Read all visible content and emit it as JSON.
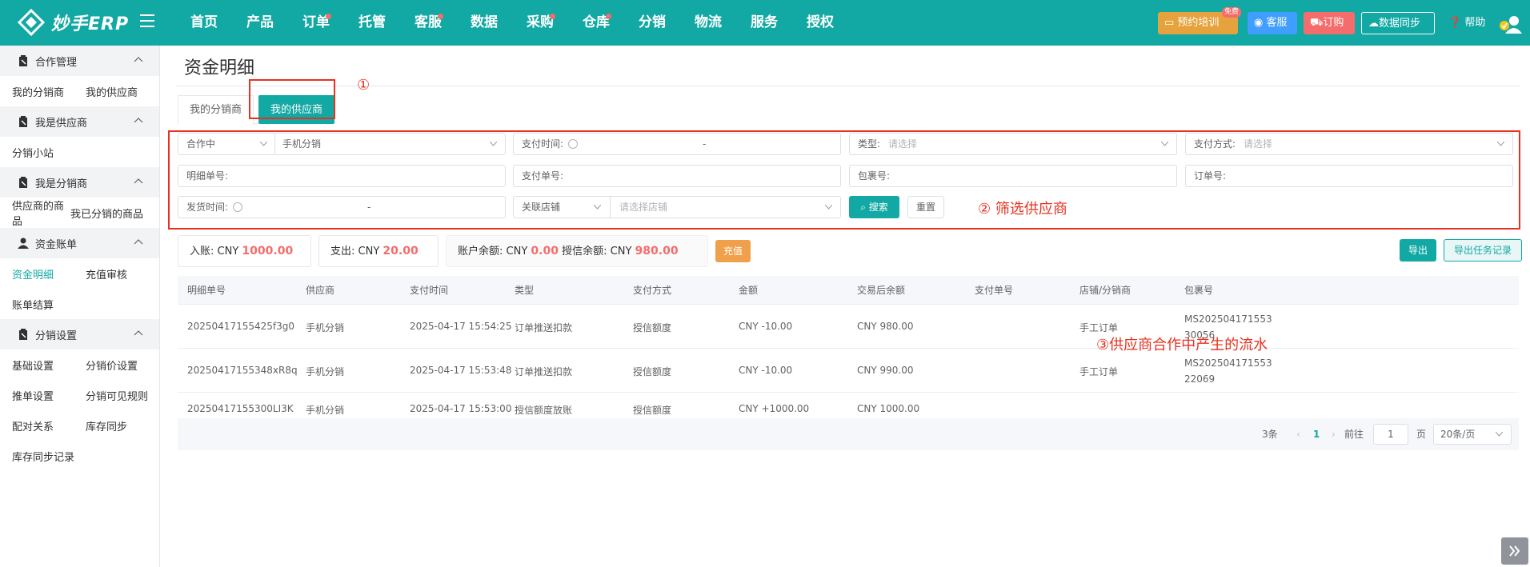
{
  "header": {
    "logo_text": "妙手ERP",
    "nav": [
      {
        "label": "首页",
        "dot": false
      },
      {
        "label": "产品",
        "dot": false
      },
      {
        "label": "订单",
        "dot": true
      },
      {
        "label": "托管",
        "dot": false
      },
      {
        "label": "客服",
        "dot": true
      },
      {
        "label": "数据",
        "dot": false
      },
      {
        "label": "采购",
        "dot": true
      },
      {
        "label": "仓库",
        "dot": true
      },
      {
        "label": "分销",
        "dot": false
      },
      {
        "label": "物流",
        "dot": false
      },
      {
        "label": "服务",
        "dot": false
      },
      {
        "label": "授权",
        "dot": false
      }
    ],
    "train_label": "预约培训",
    "train_badge": "免费",
    "cs_label": "客服",
    "order_label": "订购",
    "sync_label": "数据同步",
    "help_label": "帮助"
  },
  "sidebar": {
    "groups": [
      {
        "label": "合作管理",
        "icon": "clipboard-icon",
        "items": [
          "我的分销商",
          "我的供应商"
        ]
      },
      {
        "label": "我是供应商",
        "icon": "clipboard-icon",
        "items": [
          "分销小站"
        ]
      },
      {
        "label": "我是分销商",
        "icon": "clipboard-icon",
        "items": [
          "供应商的商品",
          "我已分销的商品"
        ]
      },
      {
        "label": "资金账单",
        "icon": "user-icon",
        "items": [
          "资金明细",
          "充值审核",
          "账单结算"
        ]
      },
      {
        "label": "分销设置",
        "icon": "clipboard-icon",
        "items": [
          "基础设置",
          "分销价设置",
          "推单设置",
          "分销可见规则",
          "配对关系",
          "库存同步",
          "库存同步记录"
        ]
      }
    ],
    "active_item": "资金明细"
  },
  "main": {
    "title": "资金明细",
    "tabs": [
      "我的分销商",
      "我的供应商"
    ],
    "active_tab": "我的供应商",
    "filters": {
      "status_select": "合作中",
      "supplier_select": "手机分销",
      "pay_time_label": "支付时间:",
      "range_dash": "-",
      "type_label": "类型:",
      "type_placeholder": "请选择",
      "pay_method_label": "支付方式:",
      "pay_method_placeholder": "请选择",
      "detail_no_label": "明细单号:",
      "pay_no_label": "支付单号:",
      "package_no_label": "包裹号:",
      "order_no_label": "订单号:",
      "ship_time_label": "发货时间:",
      "store_select": "关联店铺",
      "store_placeholder": "请选择店铺",
      "search_label": "搜索",
      "reset_label": "重置"
    },
    "summary": {
      "income_label": "入账:",
      "income_currency": "CNY",
      "income_value": "1000.00",
      "expense_label": "支出:",
      "expense_currency": "CNY",
      "expense_value": "20.00",
      "balance_label": "账户余额:",
      "balance_currency": "CNY",
      "balance_value": "0.00",
      "credit_label": "授信余额:",
      "credit_currency": "CNY",
      "credit_value": "980.00",
      "recharge_label": "充值",
      "export_label": "导出",
      "export_log_label": "导出任务记录"
    },
    "table": {
      "columns": [
        "明细单号",
        "供应商",
        "支付时间",
        "类型",
        "支付方式",
        "金额",
        "交易后余额",
        "支付单号",
        "店铺/分销商",
        "包裹号"
      ],
      "rows": [
        [
          "20250417155425f3g0",
          "手机分销",
          "2025-04-17 15:54:25",
          "订单推送扣款",
          "授信额度",
          "CNY -10.00",
          "CNY 980.00",
          "",
          "手工订单",
          "MS20250417155330056"
        ],
        [
          "20250417155348xR8q",
          "手机分销",
          "2025-04-17 15:53:48",
          "订单推送扣款",
          "授信额度",
          "CNY -10.00",
          "CNY 990.00",
          "",
          "手工订单",
          "MS20250417155322069"
        ],
        [
          "20250417155300LI3K",
          "手机分销",
          "2025-04-17 15:53:00",
          "授信额度放账",
          "授信额度",
          "CNY +1000.00",
          "CNY 1000.00",
          "",
          "",
          ""
        ]
      ]
    },
    "pagination": {
      "total": "3条",
      "current_page": "1",
      "goto_label": "前往",
      "goto_value": "1",
      "page_unit": "页",
      "page_size": "20条/页"
    }
  },
  "annotations": {
    "tab_note": "①",
    "filter_note": "② 筛选供应商",
    "table_note": "③供应商合作中产生的流水"
  },
  "colors": {
    "brand": "#12a8a4",
    "accent_red": "#f56c6c",
    "annotation": "#e8321f",
    "recharge": "#f0a04b"
  }
}
